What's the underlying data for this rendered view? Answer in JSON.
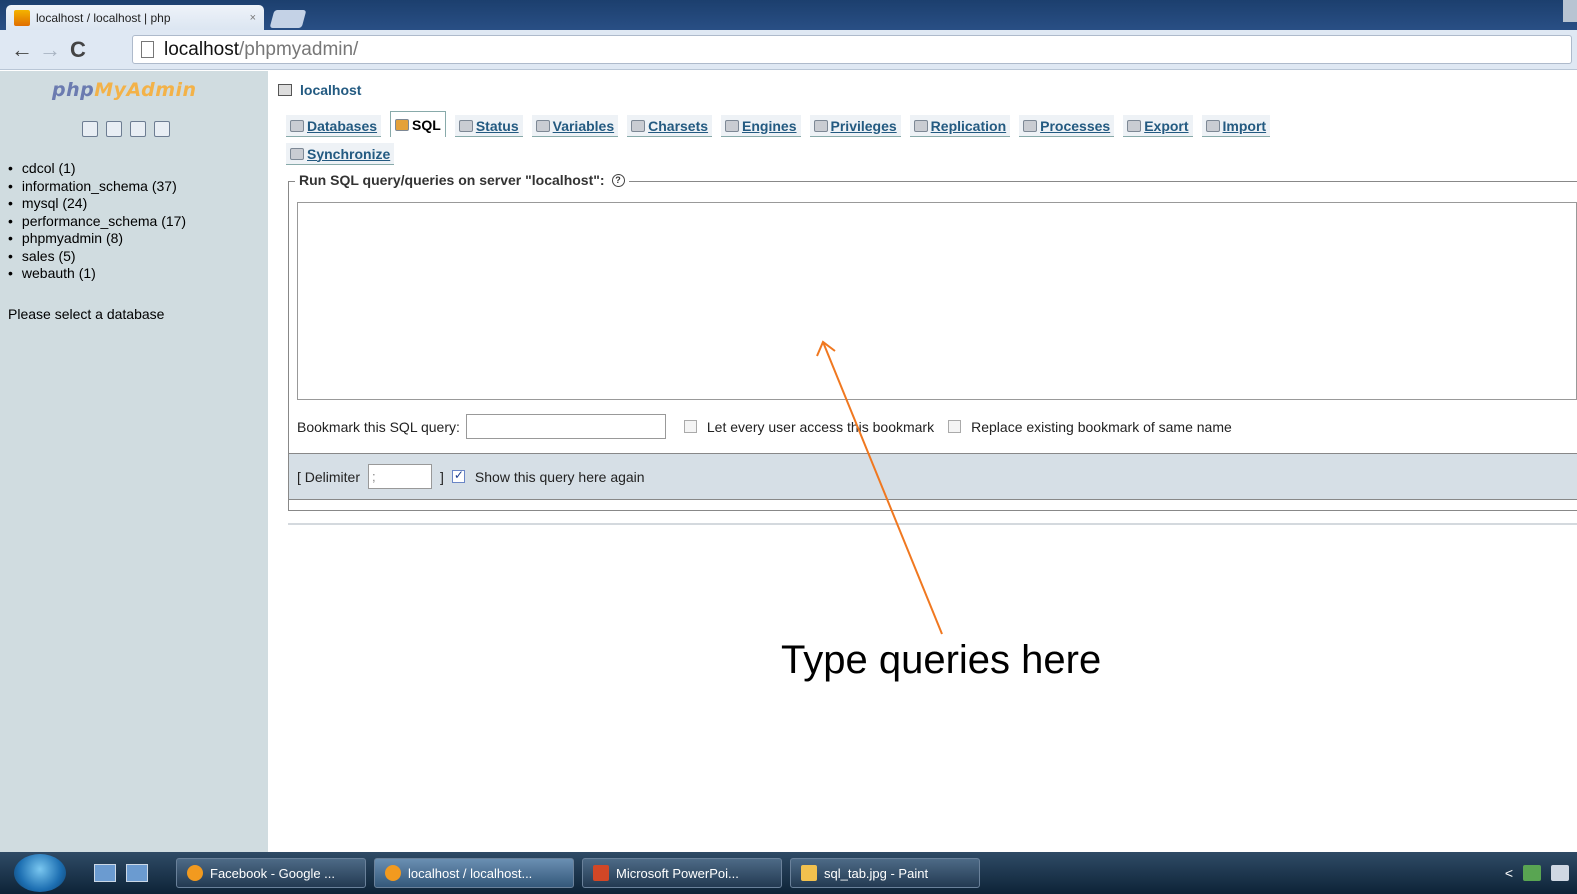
{
  "browser": {
    "tab_title": "localhost / localhost | php",
    "tab_close": "×",
    "url_host": "localhost",
    "url_path": "/phpmyadmin/"
  },
  "sidebar": {
    "logo_php": "php",
    "logo_my": "MyAdmin",
    "databases": [
      "cdcol (1)",
      "information_schema (37)",
      "mysql (24)",
      "performance_schema (17)",
      "phpmyadmin (8)",
      "sales (5)",
      "webauth (1)"
    ],
    "select_message": "Please select a database"
  },
  "main": {
    "server": "localhost",
    "tabs": {
      "databases": "Databases",
      "sql": "SQL",
      "status": "Status",
      "variables": "Variables",
      "charsets": "Charsets",
      "engines": "Engines",
      "privileges": "Privileges",
      "replication": "Replication",
      "processes": "Processes",
      "export": "Export",
      "import": "Import",
      "synchronize": "Synchronize"
    },
    "legend": "Run SQL query/queries on server \"localhost\":",
    "query_text": "",
    "bookmark_label": "Bookmark this SQL query:",
    "bookmark_value": "",
    "let_every_user": "Let every user access this bookmark",
    "replace_existing": "Replace existing bookmark of same name",
    "delimiter_open": "[ Delimiter",
    "delimiter_value": ";",
    "delimiter_close": "]",
    "show_again": "Show this query here again"
  },
  "annotation": {
    "text": "Type queries here",
    "color": "#f07820"
  },
  "taskbar": {
    "items": [
      "Facebook - Google ...",
      "localhost / localhost...",
      "Microsoft PowerPoi...",
      "sql_tab.jpg - Paint"
    ],
    "tray_arrow": "<"
  }
}
